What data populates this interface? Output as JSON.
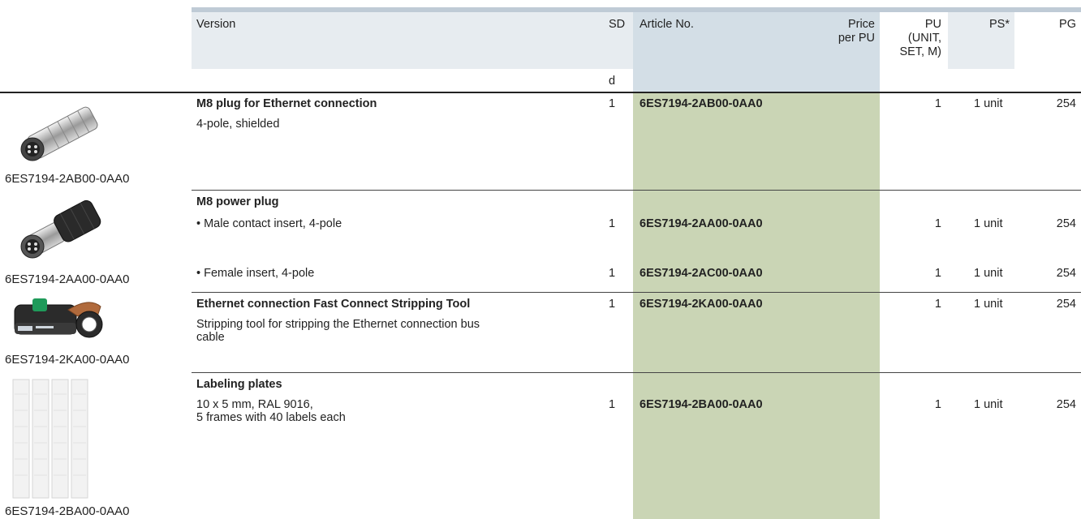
{
  "header": {
    "version": "Version",
    "sd": "SD",
    "sd_unit": "d",
    "article_no": "Article No.",
    "price_line1": "Price",
    "price_line2": "per PU",
    "pu_line1": "PU",
    "pu_line2": "(UNIT,",
    "pu_line3": "SET, M)",
    "ps": "PS*",
    "pg": "PG"
  },
  "rows": [
    {
      "image_caption": "6ES7194-2AB00-0AA0",
      "title": "M8 plug for Ethernet connection",
      "desc": "4-pole, shielded",
      "sd": "1",
      "article": "6ES7194-2AB00-0AA0",
      "pu": "1",
      "ps": "1 unit",
      "pg": "254"
    },
    {
      "image_caption": "6ES7194-2AA00-0AA0",
      "title": "M8 power plug",
      "items": [
        {
          "desc": "• Male contact insert, 4-pole",
          "sd": "1",
          "article": "6ES7194-2AA00-0AA0",
          "pu": "1",
          "ps": "1 unit",
          "pg": "254"
        },
        {
          "desc": "• Female insert, 4-pole",
          "sd": "1",
          "article": "6ES7194-2AC00-0AA0",
          "pu": "1",
          "ps": "1 unit",
          "pg": "254"
        }
      ]
    },
    {
      "image_caption": "6ES7194-2KA00-0AA0",
      "title": "Ethernet connection Fast Connect Stripping Tool",
      "desc_line1": "Stripping tool for stripping the Ethernet connection bus",
      "desc_line2": "cable",
      "sd": "1",
      "article": "6ES7194-2KA00-0AA0",
      "pu": "1",
      "ps": "1 unit",
      "pg": "254"
    },
    {
      "image_caption": "6ES7194-2BA00-0AA0",
      "title": "Labeling plates",
      "desc_line1": "10 x 5 mm, RAL 9016,",
      "desc_line2": "5 frames with 40 labels each",
      "sd": "1",
      "article": "6ES7194-2BA00-0AA0",
      "pu": "1",
      "ps": "1 unit",
      "pg": "254"
    }
  ],
  "colors": {
    "header_bg": "#e7ecf0",
    "article_header_bg": "#d3dee6",
    "article_col_bg": "#cad5b5",
    "top_bar": "#bfcbd6"
  }
}
